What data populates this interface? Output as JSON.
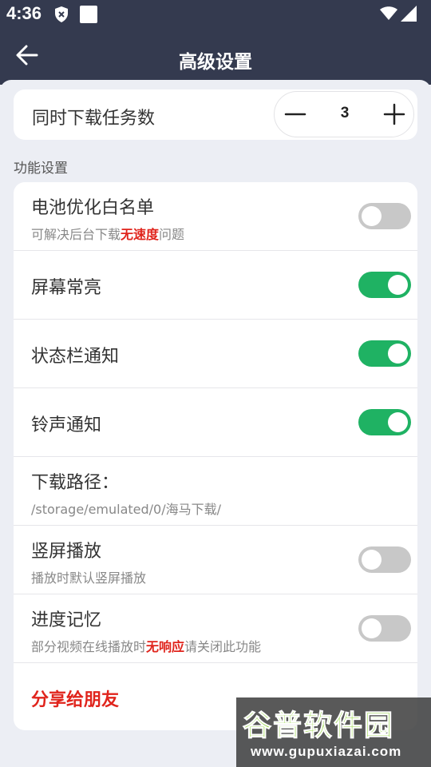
{
  "status_bar": {
    "time": "4:36"
  },
  "header": {
    "title": "高级设置"
  },
  "download_tasks": {
    "label": "同时下载任务数",
    "value": "3"
  },
  "section_title": "功能设置",
  "settings": [
    {
      "title": "电池优化白名单",
      "sub_before": "可解决后台下载",
      "sub_highlight": "无速度",
      "sub_after": "问题",
      "toggle_on": false
    },
    {
      "title": "屏幕常亮",
      "toggle_on": true
    },
    {
      "title": "状态栏通知",
      "toggle_on": true
    },
    {
      "title": "铃声通知",
      "toggle_on": true
    },
    {
      "title": "下载路径：",
      "sub": "/storage/emulated/0/海马下载/"
    },
    {
      "title": "竖屏播放",
      "sub": "播放时默认竖屏播放",
      "toggle_on": false
    },
    {
      "title": "进度记忆",
      "sub_before": "部分视频在线播放时",
      "sub_highlight": "无响应",
      "sub_after": "请关闭此功能",
      "toggle_on": false
    },
    {
      "title": "分享给朋友"
    }
  ],
  "watermark": {
    "title": "谷普软件园",
    "url": "www.gupuxiazai.com"
  },
  "colors": {
    "bar": "#343a4f",
    "toggle_on": "#1fb263",
    "toggle_off": "#c8c8c8",
    "highlight": "#e0241c"
  }
}
